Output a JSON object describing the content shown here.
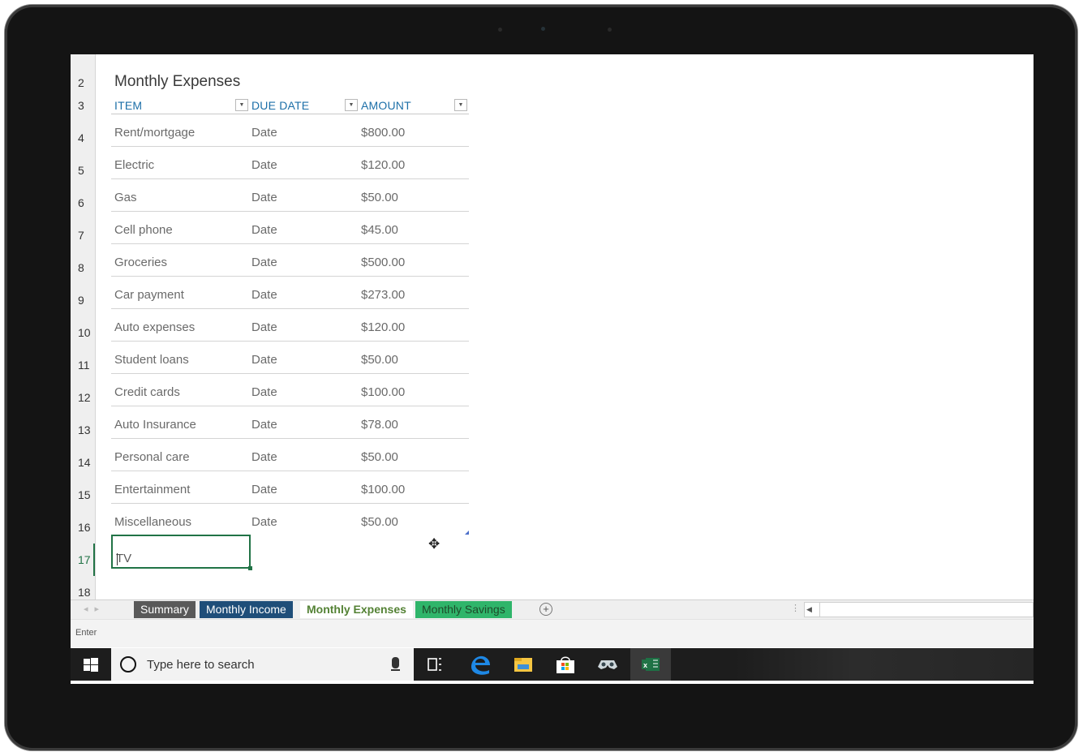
{
  "sheet": {
    "title": "Monthly Expenses",
    "columns": [
      "ITEM",
      "DUE DATE",
      "AMOUNT"
    ],
    "row_numbers": [
      "2",
      "3",
      "4",
      "5",
      "6",
      "7",
      "8",
      "9",
      "10",
      "11",
      "12",
      "13",
      "14",
      "15",
      "16",
      "17",
      "18"
    ],
    "rows": [
      {
        "item": "Rent/mortgage",
        "due": "Date",
        "amount": "$800.00"
      },
      {
        "item": "Electric",
        "due": "Date",
        "amount": "$120.00"
      },
      {
        "item": "Gas",
        "due": "Date",
        "amount": "$50.00"
      },
      {
        "item": "Cell phone",
        "due": "Date",
        "amount": "$45.00"
      },
      {
        "item": "Groceries",
        "due": "Date",
        "amount": "$500.00"
      },
      {
        "item": "Car payment",
        "due": "Date",
        "amount": "$273.00"
      },
      {
        "item": "Auto expenses",
        "due": "Date",
        "amount": "$120.00"
      },
      {
        "item": "Student loans",
        "due": "Date",
        "amount": "$50.00"
      },
      {
        "item": "Credit cards",
        "due": "Date",
        "amount": "$100.00"
      },
      {
        "item": "Auto Insurance",
        "due": "Date",
        "amount": "$78.00"
      },
      {
        "item": "Personal care",
        "due": "Date",
        "amount": "$50.00"
      },
      {
        "item": "Entertainment",
        "due": "Date",
        "amount": "$100.00"
      },
      {
        "item": "Miscellaneous",
        "due": "Date",
        "amount": "$50.00"
      }
    ],
    "editing_value": "TV",
    "active_row": "17"
  },
  "tabs": [
    {
      "label": "Summary",
      "bg": "#595959",
      "fg": "#ffffff"
    },
    {
      "label": "Monthly Income",
      "bg": "#1f4e79",
      "fg": "#ffffff"
    },
    {
      "label": "Monthly Expenses",
      "bg": "#ffffff",
      "fg": "#548235",
      "active": true
    },
    {
      "label": "Monthly Savings",
      "bg": "#2fb56a",
      "fg": "#1e4a2a"
    }
  ],
  "status": {
    "mode": "Enter"
  },
  "taskbar": {
    "search_placeholder": "Type here to search",
    "icons": [
      "windows-start-icon",
      "microphone-icon",
      "task-view-icon",
      "edge-icon",
      "file-explorer-icon",
      "store-icon",
      "mixed-reality-icon",
      "excel-icon"
    ]
  },
  "colors": {
    "accent": "#217346",
    "header_text": "#1c6fa8"
  }
}
